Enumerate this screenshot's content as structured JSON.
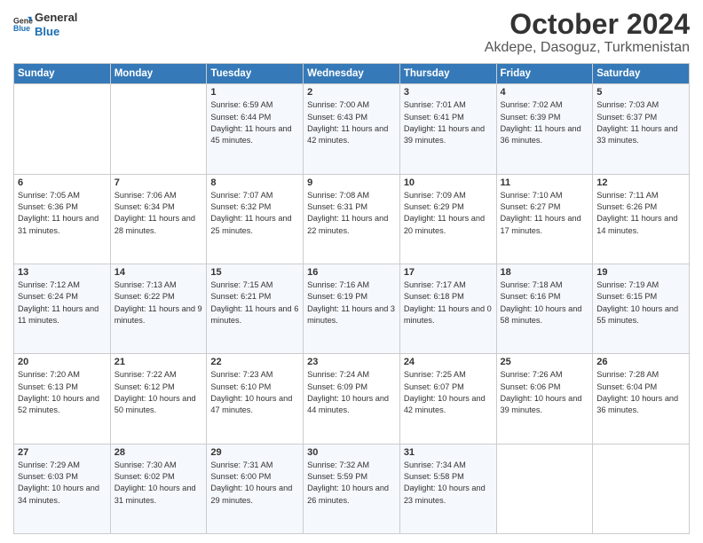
{
  "logo": {
    "line1": "General",
    "line2": "Blue"
  },
  "title": "October 2024",
  "subtitle": "Akdepe, Dasoguz, Turkmenistan",
  "days_of_week": [
    "Sunday",
    "Monday",
    "Tuesday",
    "Wednesday",
    "Thursday",
    "Friday",
    "Saturday"
  ],
  "weeks": [
    [
      {
        "day": "",
        "info": ""
      },
      {
        "day": "",
        "info": ""
      },
      {
        "day": "1",
        "info": "Sunrise: 6:59 AM\nSunset: 6:44 PM\nDaylight: 11 hours and 45 minutes."
      },
      {
        "day": "2",
        "info": "Sunrise: 7:00 AM\nSunset: 6:43 PM\nDaylight: 11 hours and 42 minutes."
      },
      {
        "day": "3",
        "info": "Sunrise: 7:01 AM\nSunset: 6:41 PM\nDaylight: 11 hours and 39 minutes."
      },
      {
        "day": "4",
        "info": "Sunrise: 7:02 AM\nSunset: 6:39 PM\nDaylight: 11 hours and 36 minutes."
      },
      {
        "day": "5",
        "info": "Sunrise: 7:03 AM\nSunset: 6:37 PM\nDaylight: 11 hours and 33 minutes."
      }
    ],
    [
      {
        "day": "6",
        "info": "Sunrise: 7:05 AM\nSunset: 6:36 PM\nDaylight: 11 hours and 31 minutes."
      },
      {
        "day": "7",
        "info": "Sunrise: 7:06 AM\nSunset: 6:34 PM\nDaylight: 11 hours and 28 minutes."
      },
      {
        "day": "8",
        "info": "Sunrise: 7:07 AM\nSunset: 6:32 PM\nDaylight: 11 hours and 25 minutes."
      },
      {
        "day": "9",
        "info": "Sunrise: 7:08 AM\nSunset: 6:31 PM\nDaylight: 11 hours and 22 minutes."
      },
      {
        "day": "10",
        "info": "Sunrise: 7:09 AM\nSunset: 6:29 PM\nDaylight: 11 hours and 20 minutes."
      },
      {
        "day": "11",
        "info": "Sunrise: 7:10 AM\nSunset: 6:27 PM\nDaylight: 11 hours and 17 minutes."
      },
      {
        "day": "12",
        "info": "Sunrise: 7:11 AM\nSunset: 6:26 PM\nDaylight: 11 hours and 14 minutes."
      }
    ],
    [
      {
        "day": "13",
        "info": "Sunrise: 7:12 AM\nSunset: 6:24 PM\nDaylight: 11 hours and 11 minutes."
      },
      {
        "day": "14",
        "info": "Sunrise: 7:13 AM\nSunset: 6:22 PM\nDaylight: 11 hours and 9 minutes."
      },
      {
        "day": "15",
        "info": "Sunrise: 7:15 AM\nSunset: 6:21 PM\nDaylight: 11 hours and 6 minutes."
      },
      {
        "day": "16",
        "info": "Sunrise: 7:16 AM\nSunset: 6:19 PM\nDaylight: 11 hours and 3 minutes."
      },
      {
        "day": "17",
        "info": "Sunrise: 7:17 AM\nSunset: 6:18 PM\nDaylight: 11 hours and 0 minutes."
      },
      {
        "day": "18",
        "info": "Sunrise: 7:18 AM\nSunset: 6:16 PM\nDaylight: 10 hours and 58 minutes."
      },
      {
        "day": "19",
        "info": "Sunrise: 7:19 AM\nSunset: 6:15 PM\nDaylight: 10 hours and 55 minutes."
      }
    ],
    [
      {
        "day": "20",
        "info": "Sunrise: 7:20 AM\nSunset: 6:13 PM\nDaylight: 10 hours and 52 minutes."
      },
      {
        "day": "21",
        "info": "Sunrise: 7:22 AM\nSunset: 6:12 PM\nDaylight: 10 hours and 50 minutes."
      },
      {
        "day": "22",
        "info": "Sunrise: 7:23 AM\nSunset: 6:10 PM\nDaylight: 10 hours and 47 minutes."
      },
      {
        "day": "23",
        "info": "Sunrise: 7:24 AM\nSunset: 6:09 PM\nDaylight: 10 hours and 44 minutes."
      },
      {
        "day": "24",
        "info": "Sunrise: 7:25 AM\nSunset: 6:07 PM\nDaylight: 10 hours and 42 minutes."
      },
      {
        "day": "25",
        "info": "Sunrise: 7:26 AM\nSunset: 6:06 PM\nDaylight: 10 hours and 39 minutes."
      },
      {
        "day": "26",
        "info": "Sunrise: 7:28 AM\nSunset: 6:04 PM\nDaylight: 10 hours and 36 minutes."
      }
    ],
    [
      {
        "day": "27",
        "info": "Sunrise: 7:29 AM\nSunset: 6:03 PM\nDaylight: 10 hours and 34 minutes."
      },
      {
        "day": "28",
        "info": "Sunrise: 7:30 AM\nSunset: 6:02 PM\nDaylight: 10 hours and 31 minutes."
      },
      {
        "day": "29",
        "info": "Sunrise: 7:31 AM\nSunset: 6:00 PM\nDaylight: 10 hours and 29 minutes."
      },
      {
        "day": "30",
        "info": "Sunrise: 7:32 AM\nSunset: 5:59 PM\nDaylight: 10 hours and 26 minutes."
      },
      {
        "day": "31",
        "info": "Sunrise: 7:34 AM\nSunset: 5:58 PM\nDaylight: 10 hours and 23 minutes."
      },
      {
        "day": "",
        "info": ""
      },
      {
        "day": "",
        "info": ""
      }
    ]
  ]
}
